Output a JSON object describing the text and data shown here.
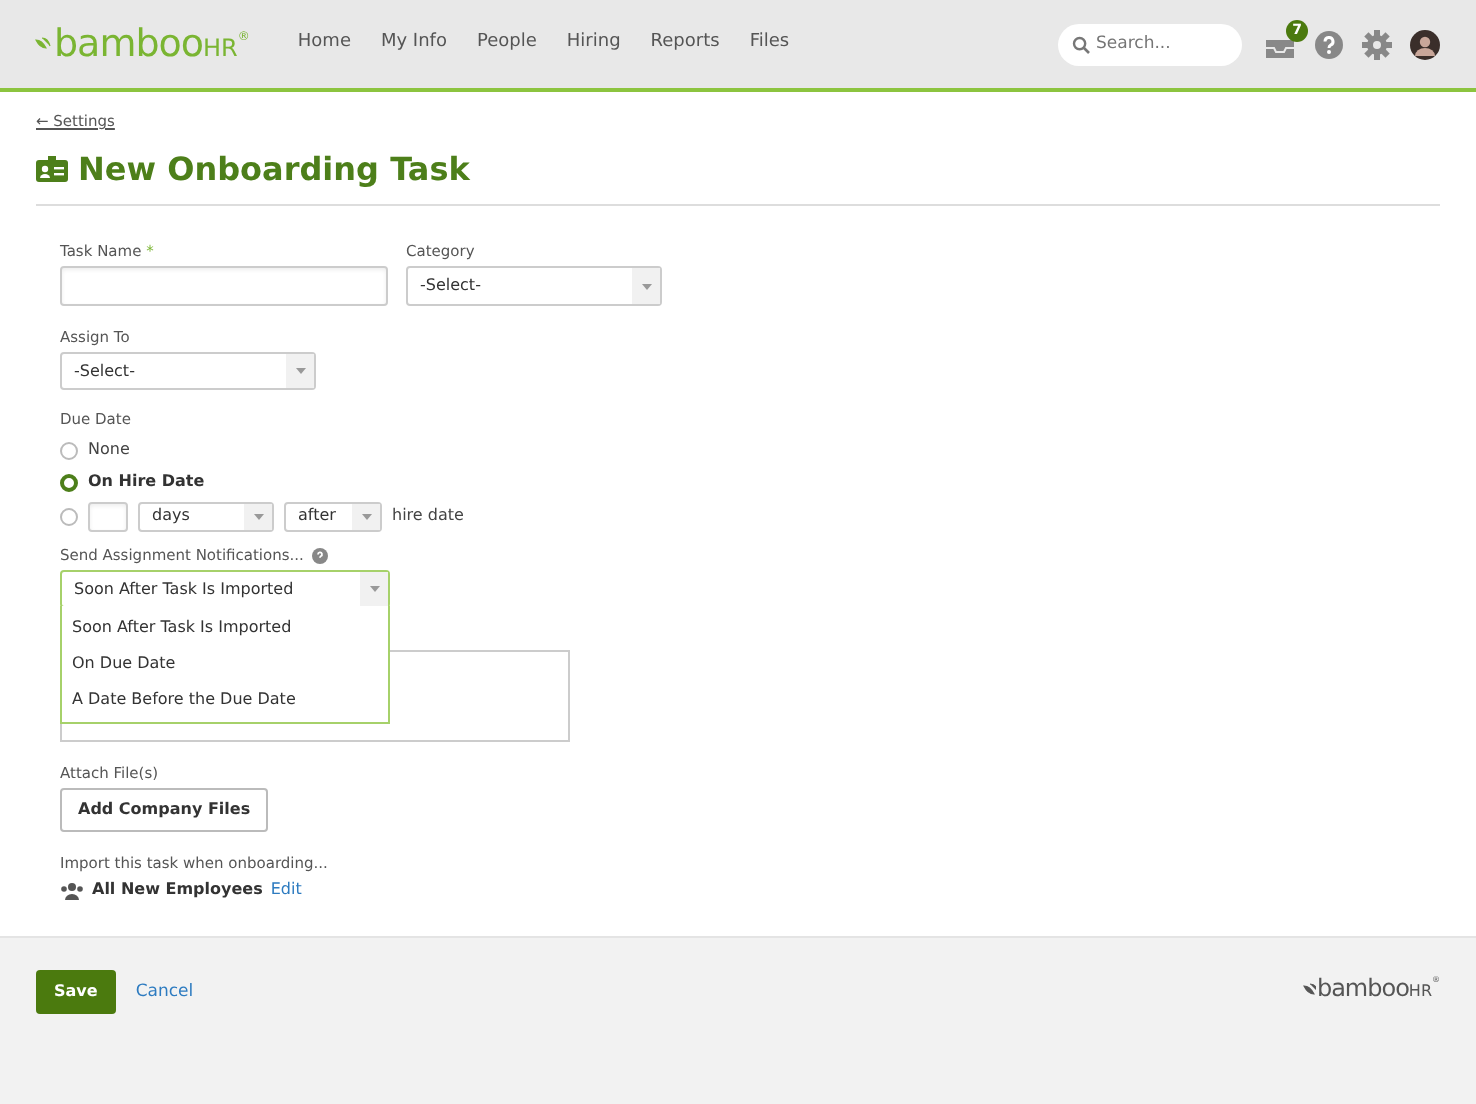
{
  "header": {
    "logo": {
      "main": "bamboo",
      "suffix": "HR",
      "mark": "®"
    },
    "nav": [
      {
        "label": "Home",
        "selected": false
      },
      {
        "label": "My Info",
        "selected": false
      },
      {
        "label": "People",
        "selected": false
      },
      {
        "label": "Hiring",
        "selected": false
      },
      {
        "label": "Reports",
        "selected": false
      },
      {
        "label": "Files",
        "selected": false
      }
    ],
    "search": {
      "placeholder": "Search..."
    },
    "inbox_count": "7"
  },
  "breadcrumb": "← Settings",
  "title": "New Onboarding Task",
  "form": {
    "task_name": {
      "label": "Task Name",
      "required": "*"
    },
    "category": {
      "label": "Category",
      "value": "-Select-"
    },
    "assign_to": {
      "label": "Assign To",
      "value": "-Select-"
    },
    "due_date": {
      "label": "Due Date",
      "options": [
        {
          "kind": "plain",
          "label": "None",
          "selected": false
        },
        {
          "kind": "plain",
          "label": "On Hire Date",
          "selected": true
        },
        {
          "kind": "offset",
          "selected": false,
          "unit": "days",
          "direction": "after",
          "suffix": "hire date"
        }
      ]
    },
    "notifications": {
      "label": "Send Assignment Notifications...",
      "value": "Soon After Task Is Imported",
      "expanded": true,
      "options": [
        "Soon After Task Is Imported",
        "On Due Date",
        "A Date Before the Due Date"
      ]
    },
    "attach": {
      "label": "Attach File(s)",
      "button": "Add Company Files"
    },
    "import": {
      "label": "Import this task when onboarding...",
      "group": "All New Employees",
      "edit": "Edit"
    }
  },
  "footer": {
    "save": "Save",
    "cancel": "Cancel",
    "logo": {
      "main": "bamboo",
      "suffix": "HR",
      "mark": "®"
    }
  }
}
